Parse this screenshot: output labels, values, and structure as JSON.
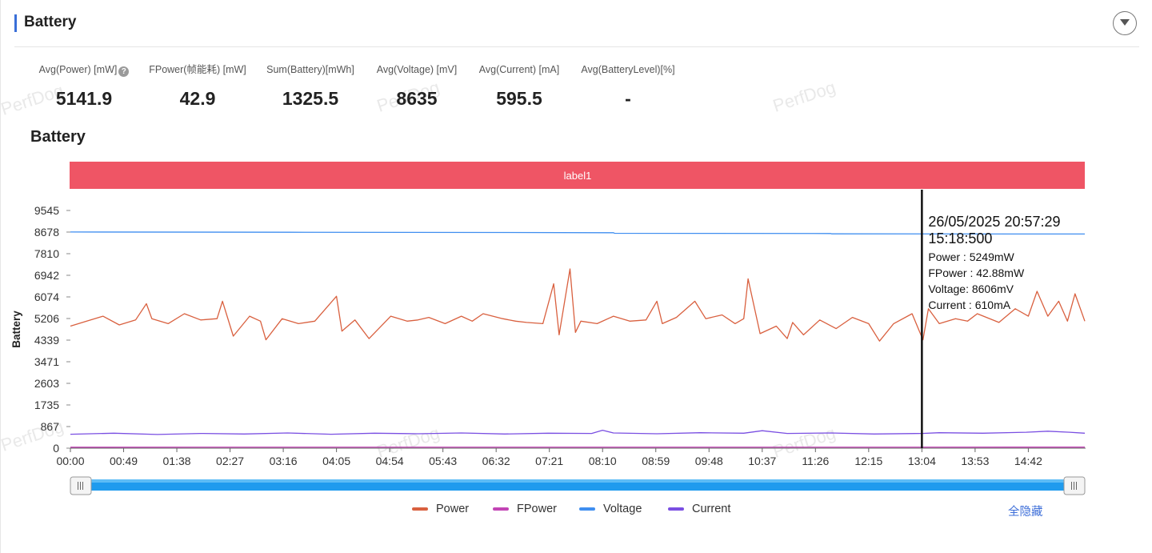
{
  "panel": {
    "title": "Battery"
  },
  "watermark": "PerfDog",
  "metrics": [
    {
      "label": "Avg(Power) [mW]",
      "value": "5141.9",
      "help": true
    },
    {
      "label": "FPower(帧能耗) [mW]",
      "value": "42.9"
    },
    {
      "label": "Sum(Battery)[mWh]",
      "value": "1325.5"
    },
    {
      "label": "Avg(Voltage) [mV]",
      "value": "8635"
    },
    {
      "label": "Avg(Current) [mA]",
      "value": "595.5"
    },
    {
      "label": "Avg(BatteryLevel)[%]",
      "value": "-"
    }
  ],
  "chart_data": {
    "type": "line",
    "title": "Battery",
    "ylabel": "Battery",
    "xlabel": "",
    "y_ticks": [
      0,
      867,
      1735,
      2603,
      3471,
      4339,
      5206,
      6074,
      6942,
      7810,
      8678,
      9545
    ],
    "ylim": [
      0,
      9545
    ],
    "x_ticks": [
      "00:00",
      "00:49",
      "01:38",
      "02:27",
      "03:16",
      "04:05",
      "04:54",
      "05:43",
      "06:32",
      "07:21",
      "08:10",
      "08:59",
      "09:48",
      "10:37",
      "11:26",
      "12:15",
      "13:04",
      "13:53",
      "14:42"
    ],
    "x_tick_seconds": [
      0,
      49,
      98,
      147,
      196,
      245,
      294,
      343,
      392,
      441,
      490,
      539,
      588,
      637,
      686,
      735,
      784,
      833,
      882
    ],
    "xlim_seconds": [
      0,
      934
    ],
    "label_band": {
      "text": "label1",
      "color": "#ef5565"
    },
    "series": [
      {
        "name": "Power",
        "color": "#d9603f",
        "x": [
          0,
          15,
          30,
          45,
          60,
          70,
          75,
          90,
          105,
          120,
          135,
          140,
          150,
          165,
          175,
          180,
          195,
          210,
          225,
          245,
          250,
          262,
          275,
          295,
          310,
          320,
          330,
          345,
          360,
          370,
          380,
          398,
          410,
          420,
          435,
          445,
          450,
          460,
          465,
          470,
          485,
          500,
          515,
          530,
          540,
          545,
          558,
          575,
          585,
          600,
          612,
          620,
          624,
          635,
          650,
          660,
          665,
          675,
          690,
          705,
          720,
          735,
          745,
          758,
          775,
          785,
          790,
          800,
          815,
          826,
          835,
          855,
          870,
          882,
          890,
          900,
          910,
          918,
          925,
          934
        ],
        "values": [
          4900,
          5100,
          5300,
          4950,
          5150,
          5800,
          5200,
          5000,
          5400,
          5150,
          5200,
          5900,
          4500,
          5300,
          5100,
          4350,
          5200,
          5000,
          5100,
          6100,
          4700,
          5150,
          4400,
          5300,
          5100,
          5150,
          5250,
          5000,
          5300,
          5100,
          5400,
          5200,
          5100,
          5050,
          5000,
          6600,
          4550,
          7200,
          4650,
          5100,
          5000,
          5300,
          5100,
          5150,
          5900,
          5000,
          5250,
          5900,
          5200,
          5350,
          5000,
          5200,
          6800,
          4600,
          4900,
          4400,
          5050,
          4550,
          5150,
          4800,
          5250,
          5000,
          4300,
          5000,
          5400,
          4350,
          5600,
          5000,
          5200,
          5100,
          5400,
          5050,
          5600,
          5300,
          6300,
          5300,
          5900,
          5100,
          6200,
          5100
        ]
      },
      {
        "name": "FPower",
        "color": "#c244b5",
        "x": [
          0,
          934
        ],
        "values": [
          40,
          43
        ]
      },
      {
        "name": "Voltage",
        "color": "#3f8ef0",
        "x": [
          0,
          200,
          400,
          500,
          501,
          700,
          701,
          934
        ],
        "values": [
          8680,
          8670,
          8660,
          8650,
          8630,
          8620,
          8606,
          8600
        ]
      },
      {
        "name": "Current",
        "color": "#7a4fe2",
        "x": [
          0,
          40,
          80,
          120,
          160,
          200,
          240,
          280,
          320,
          360,
          400,
          440,
          480,
          490,
          500,
          540,
          580,
          620,
          637,
          660,
          700,
          740,
          784,
          800,
          840,
          880,
          900,
          920,
          934
        ],
        "values": [
          560,
          600,
          550,
          590,
          570,
          610,
          560,
          600,
          580,
          610,
          570,
          600,
          590,
          720,
          610,
          580,
          620,
          600,
          700,
          590,
          610,
          570,
          590,
          620,
          600,
          640,
          680,
          640,
          600
        ]
      }
    ],
    "grid": false,
    "legend": "bottom-center",
    "cursor": {
      "x_seconds": 784,
      "time_lines": [
        "26/05/2025 20:57:29",
        "15:18:500"
      ],
      "rows": [
        "Power   : 5249mW",
        "FPower : 42.88mW",
        "Voltage: 8606mV",
        "Current : 610mA"
      ]
    }
  },
  "legend": {
    "items": [
      "Power",
      "FPower",
      "Voltage",
      "Current"
    ],
    "hide_all": "全隐藏"
  }
}
